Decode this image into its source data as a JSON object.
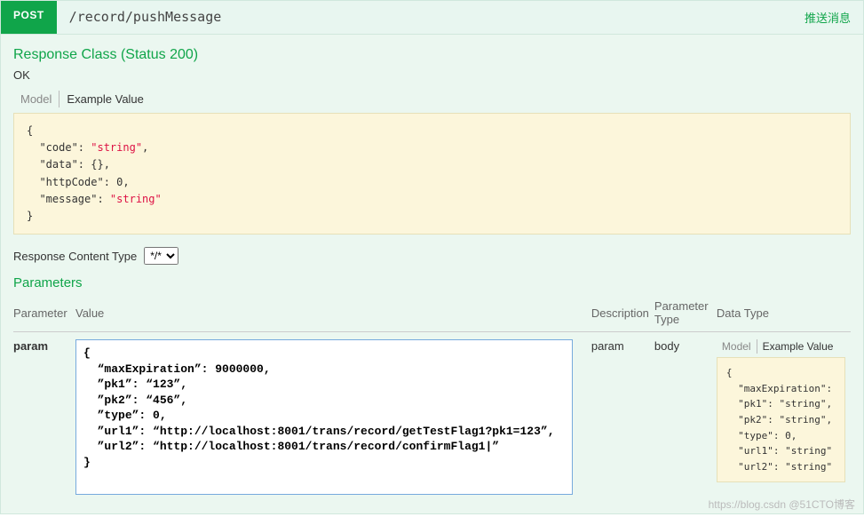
{
  "operation": {
    "method": "POST",
    "path": "/record/pushMessage",
    "summary": "推送消息"
  },
  "response": {
    "title": "Response Class (Status 200)",
    "status_text": "OK",
    "tabs": {
      "model": "Model",
      "example": "Example Value"
    },
    "example_json": {
      "opening": "{",
      "lines": [
        {
          "key": "\"code\"",
          "sep": ": ",
          "val": "\"string\"",
          "is_str": true,
          "comma": ","
        },
        {
          "key": "\"data\"",
          "sep": ": ",
          "val": "{}",
          "is_str": false,
          "comma": ","
        },
        {
          "key": "\"httpCode\"",
          "sep": ": ",
          "val": "0",
          "is_str": false,
          "comma": ","
        },
        {
          "key": "\"message\"",
          "sep": ": ",
          "val": "\"string\"",
          "is_str": true,
          "comma": ""
        }
      ],
      "closing": "}"
    }
  },
  "content_type": {
    "label": "Response Content Type",
    "selected": "*/*"
  },
  "parameters": {
    "title": "Parameters",
    "headers": {
      "parameter": "Parameter",
      "value": "Value",
      "description": "Description",
      "ptype": "Parameter Type",
      "dtype": "Data Type"
    },
    "row": {
      "name": "param",
      "body_value": "{\n  “maxExpiration”: 9000000,\n  ”pk1”: “123”,\n  ”pk2”: “456”,\n  ”type”: 0,\n  ”url1”: “http://localhost:8001/trans/record/getTestFlag1?pk1=123”,\n  ”url2”: “http://localhost:8001/trans/record/confirmFlag1|”\n}",
      "description": "param",
      "ptype": "body",
      "dtype_tabs": {
        "model": "Model",
        "example": "Example Value"
      },
      "dtype_example": {
        "opening": "{",
        "lines": [
          {
            "key": "\"maxExpiration\"",
            "sep": ":",
            "val": "",
            "is_str": false,
            "comma": ""
          },
          {
            "key": "\"pk1\"",
            "sep": ": ",
            "val": "\"string\"",
            "is_str": true,
            "comma": ","
          },
          {
            "key": "\"pk2\"",
            "sep": ": ",
            "val": "\"string\"",
            "is_str": true,
            "comma": ","
          },
          {
            "key": "\"type\"",
            "sep": ": ",
            "val": "0",
            "is_str": false,
            "comma": ","
          },
          {
            "key": "\"url1\"",
            "sep": ": ",
            "val": "\"string\"",
            "is_str": true,
            "comma": ""
          },
          {
            "key": "\"url2\"",
            "sep": ": ",
            "val": "\"string\"",
            "is_str": true,
            "comma": ""
          }
        ]
      }
    }
  },
  "watermark": "https://blog.csdn  @51CTO博客"
}
